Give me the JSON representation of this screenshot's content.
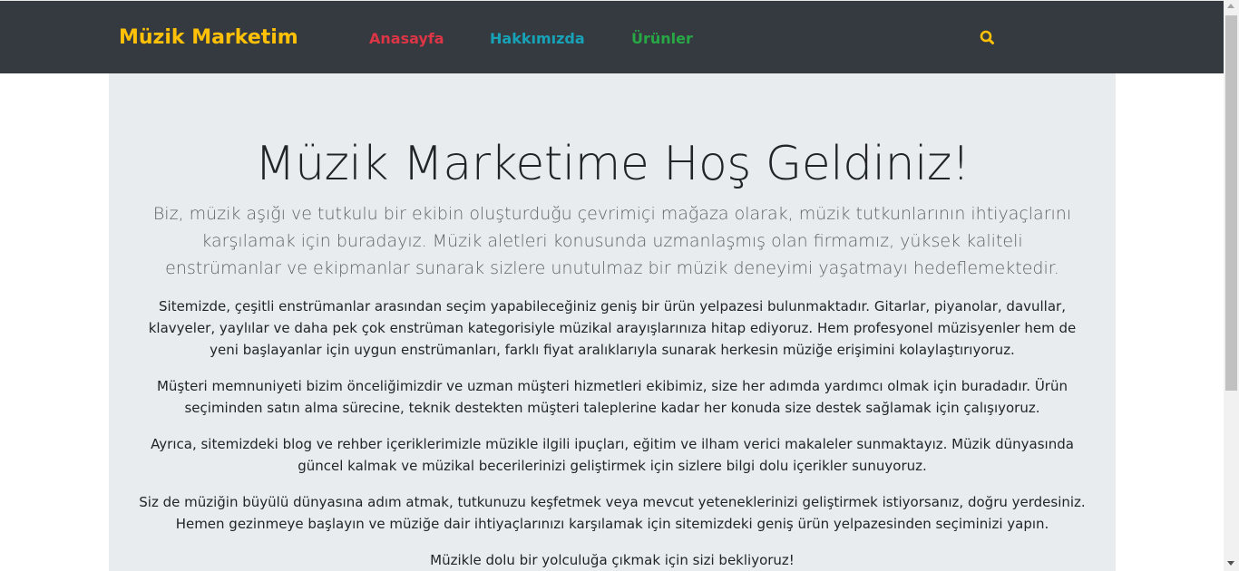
{
  "navbar": {
    "brand": "Müzik Marketim",
    "links": [
      {
        "label": "Anasayfa",
        "color": "#dc3545"
      },
      {
        "label": "Hakkımızda",
        "color": "#17a2b8"
      },
      {
        "label": "Ürünler",
        "color": "#28a745"
      }
    ],
    "search_icon": "search-icon",
    "background": "#343a40",
    "brand_color": "#ffc107"
  },
  "jumbotron": {
    "title": "Müzik Marketime Hoş Geldiniz!",
    "lead": "Biz, müzik aşığı ve tutkulu bir ekibin oluşturduğu çevrimiçi mağaza olarak, müzik tutkunlarının ihtiyaçlarını karşılamak için buradayız. Müzik aletleri konusunda uzmanlaşmış olan firmamız, yüksek kaliteli enstrümanlar ve ekipmanlar sunarak sizlere unutulmaz bir müzik deneyimi yaşatmayı hedeflemektedir.",
    "paragraphs": [
      "Sitemizde, çeşitli enstrümanlar arasından seçim yapabileceğiniz geniş bir ürün yelpazesi bulunmaktadır. Gitarlar, piyanolar, davullar, klavyeler, yaylılar ve daha pek çok enstrüman kategorisiyle müzikal arayışlarınıza hitap ediyoruz. Hem profesyonel müzisyenler hem de yeni başlayanlar için uygun enstrümanları, farklı fiyat aralıklarıyla sunarak herkesin müziğe erişimini kolaylaştırıyoruz.",
      "Müşteri memnuniyeti bizim önceliğimizdir ve uzman müşteri hizmetleri ekibimiz, size her adımda yardımcı olmak için buradadır. Ürün seçiminden satın alma sürecine, teknik destekten müşteri taleplerine kadar her konuda size destek sağlamak için çalışıyoruz.",
      "Ayrıca, sitemizdeki blog ve rehber içeriklerimizle müzikle ilgili ipuçları, eğitim ve ilham verici makaleler sunmaktayız. Müzik dünyasında güncel kalmak ve müzikal becerilerinizi geliştirmek için sizlere bilgi dolu içerikler sunuyoruz.",
      "Siz de müziğin büyülü dünyasına adım atmak, tutkunuzu keşfetmek veya mevcut yeteneklerinizi geliştirmek istiyorsanız, doğru yerdesiniz. Hemen gezinmeye başlayın ve müziğe dair ihtiyaçlarınızı karşılamak için sitemizdeki geniş ürün yelpazesinden seçiminizi yapın.",
      "Müzikle dolu bir yolculuğa çıkmak için sizi bekliyoruz!"
    ],
    "background": "#e9ecef"
  }
}
